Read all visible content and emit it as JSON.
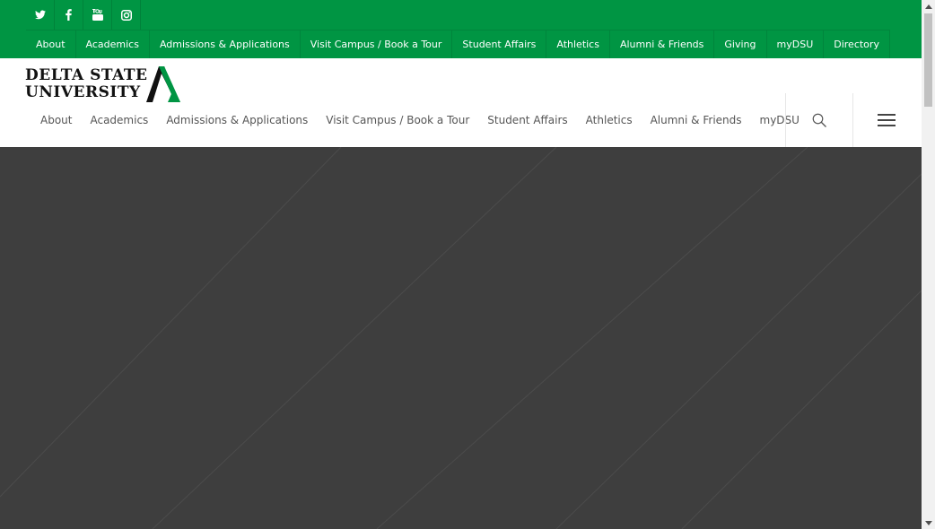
{
  "social": [
    {
      "name": "twitter-icon"
    },
    {
      "name": "facebook-icon"
    },
    {
      "name": "youtube-icon"
    },
    {
      "name": "instagram-icon"
    }
  ],
  "top_nav": [
    "About",
    "Academics",
    "Admissions & Applications",
    "Visit Campus / Book a Tour",
    "Student Affairs",
    "Athletics",
    "Alumni & Friends",
    "Giving",
    "myDSU",
    "Directory"
  ],
  "logo": {
    "line1": "DELTA STATE",
    "line2": "UNIVERSITY"
  },
  "main_nav": [
    "About",
    "Academics",
    "Admissions & Applications",
    "Visit Campus / Book a Tour",
    "Student Affairs",
    "Athletics",
    "Alumni & Friends",
    "myDSU"
  ],
  "colors": {
    "brand_green": "#009543",
    "hero_bg": "#3e3e3e"
  },
  "icons": {
    "search": "search-icon",
    "menu": "hamburger-menu-icon"
  }
}
